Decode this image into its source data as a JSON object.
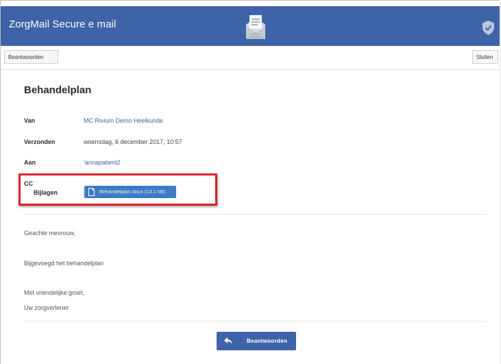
{
  "header": {
    "app_title": "ZorgMail Secure e mail",
    "envelope_icon": "envelope-open-icon",
    "shield_icon": "shield-check-icon",
    "brand_color": "#3f63a8"
  },
  "toolbar": {
    "reply_label": "Beantwoorden",
    "close_label": "Sluiten"
  },
  "message": {
    "subject": "Behandelplan",
    "fields": {
      "from_label": "Van",
      "from_value": "MC Rivium Demo Heelkunde",
      "sent_label": "Verzonden",
      "sent_value": "woensdag, 6 december 2017, 10:57",
      "to_label": "Aan",
      "to_value": "'annapatient2",
      "cc_label": "CC",
      "attachments_label": "Bijlagen"
    },
    "attachment": {
      "label": "Behandelplan.docx (13.1 kB)",
      "icon": "document-icon",
      "color": "#3d7cc4"
    },
    "body": {
      "greeting": "Geachte mevrouw,",
      "line1": "Bijgevoegd het behandelplan",
      "closing": "Met vriendelijke groet,",
      "signature": "Uw zorgverlener"
    }
  },
  "footer": {
    "reply_label": "Beantwoorden",
    "reply_icon": "reply-arrow-icon"
  },
  "annotation": {
    "highlight_color": "#e11f26"
  }
}
